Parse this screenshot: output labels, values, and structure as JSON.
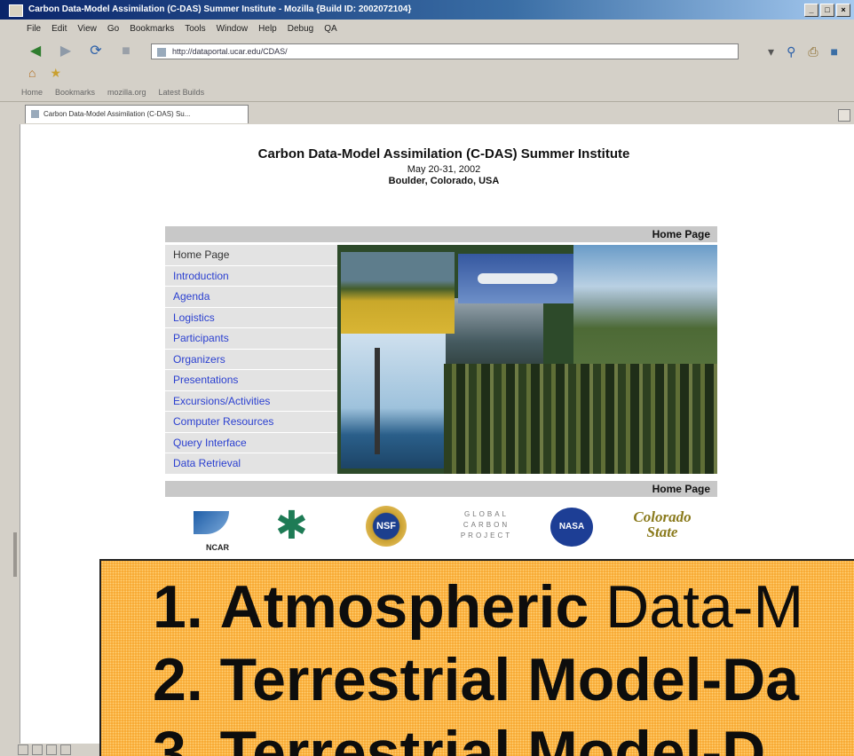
{
  "window": {
    "title": "Carbon Data-Model Assimilation (C-DAS) Summer Institute - Mozilla {Build ID: 2002072104}",
    "controls": [
      "_",
      "□",
      "×"
    ]
  },
  "menu": [
    "File",
    "Edit",
    "View",
    "Go",
    "Bookmarks",
    "Tools",
    "Window",
    "Help",
    "Debug",
    "QA"
  ],
  "url": "http://dataportal.ucar.edu/CDAS/",
  "personal_toolbar": [
    "Home",
    "Bookmarks",
    "mozilla.org",
    "Latest Builds"
  ],
  "tab_title": "Carbon Data-Model Assimilation (C-DAS) Su...",
  "page": {
    "title": "Carbon Data-Model Assimilation (C-DAS) Summer Institute",
    "dates": "May 20-31, 2002",
    "location": "Boulder, Colorado, USA",
    "header_label": "Home Page",
    "footer_label": "Home Page",
    "nav": [
      {
        "label": "Home Page",
        "current": true
      },
      {
        "label": "Introduction"
      },
      {
        "label": "Agenda"
      },
      {
        "label": "Logistics"
      },
      {
        "label": "Participants"
      },
      {
        "label": "Organizers"
      },
      {
        "label": "Presentations"
      },
      {
        "label": "Excursions/Activities"
      },
      {
        "label": "Computer Resources"
      },
      {
        "label": "Query Interface"
      },
      {
        "label": "Data Retrieval"
      }
    ],
    "logos": {
      "ncar": "NCAR",
      "nsf": "NSF",
      "gcp_line1": "GLOBAL",
      "gcp_line2": "CARBON",
      "gcp_line3": "PROJECT",
      "nasa": "NASA",
      "csu_line1": "Colorado",
      "csu_line2": "State"
    }
  },
  "overlay": {
    "line1_num": "1.",
    "line1_bold": "Atmospheric",
    "line1_rest": " Data-M",
    "line2_num": "2.",
    "line2_bold": "Terrestrial Model-Da",
    "line3_num": "3.",
    "line3_bold": "Terrestrial Model-D"
  },
  "colors": {
    "link": "#2a3fd0",
    "overlay_bg": "#f7a327",
    "nav_bg": "#e3e3e3",
    "bar_bg": "#c8c8c8"
  }
}
